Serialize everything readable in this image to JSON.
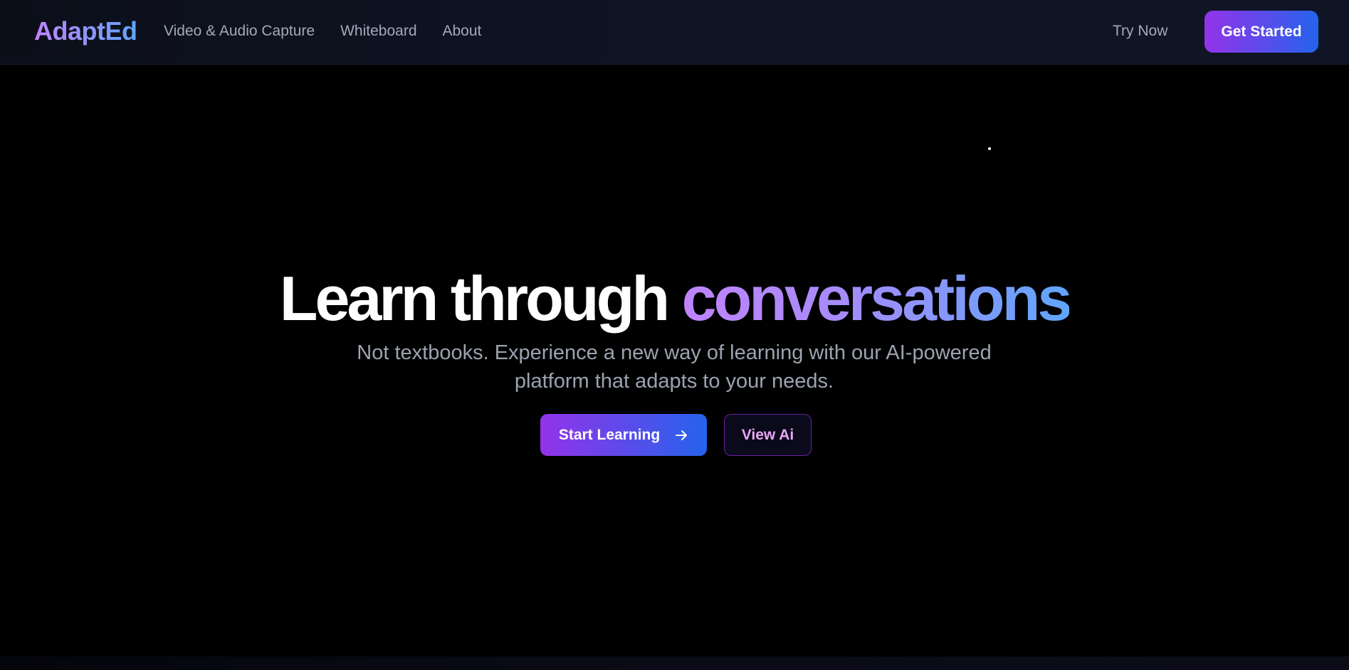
{
  "nav": {
    "logo": "AdaptEd",
    "links": [
      {
        "label": "Video & Audio Capture"
      },
      {
        "label": "Whiteboard"
      },
      {
        "label": "About"
      }
    ],
    "try_now": "Try Now",
    "get_started": "Get Started"
  },
  "hero": {
    "title_main": "Learn through ",
    "title_accent": "conversations",
    "subtitle": "Not textbooks. Experience a new way of learning with our AI-powered platform that adapts to your needs.",
    "primary_cta": "Start Learning",
    "secondary_cta": "View Ai"
  },
  "colors": {
    "background": "#000000",
    "accent_purple": "#9333ea",
    "accent_blue": "#2563eb",
    "nav_text": "#a3a9b8",
    "subtitle_text": "#9ca3af"
  },
  "icons": {
    "primary_cta_icon": "arrow-right-icon"
  }
}
